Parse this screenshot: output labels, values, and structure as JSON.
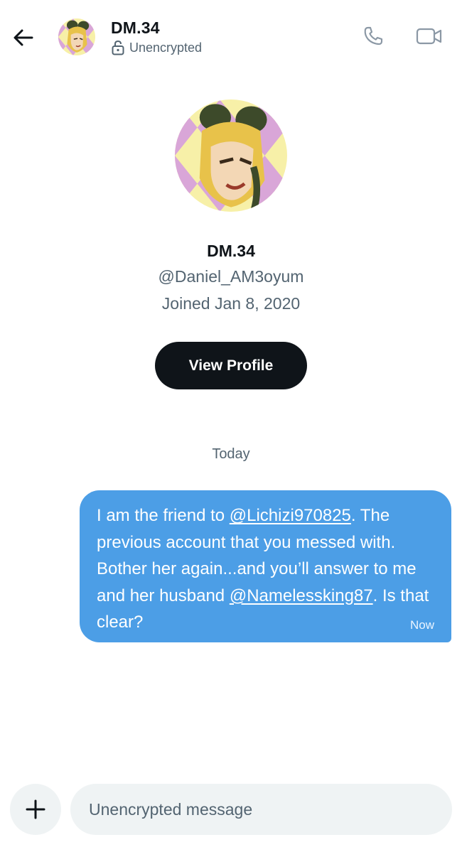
{
  "header": {
    "name": "DM.34",
    "status": "Unencrypted",
    "back_icon": "arrow-left-icon",
    "call_icon": "phone-icon",
    "video_icon": "video-camera-icon",
    "lock_icon": "unlocked-padlock-icon"
  },
  "profile": {
    "name": "DM.34",
    "handle": "@Daniel_AM3oyum",
    "joined": "Joined Jan 8, 2020",
    "view_button": "View Profile"
  },
  "conversation": {
    "date_separator": "Today",
    "messages": [
      {
        "parts": [
          "I am the friend to ",
          "@Lichizi970825",
          ". The previous account that you messed with. Bother her again...and you’ll answer to me and her husband ",
          "@Namelessking87",
          ". Is that clear?"
        ],
        "time": "Now"
      }
    ]
  },
  "composer": {
    "placeholder": "Unencrypted message",
    "add_icon": "plus-icon"
  },
  "colors": {
    "bubble": "#4c9ee6",
    "button_dark": "#0f1419",
    "muted_text": "#536471",
    "input_bg": "#eff3f4"
  }
}
